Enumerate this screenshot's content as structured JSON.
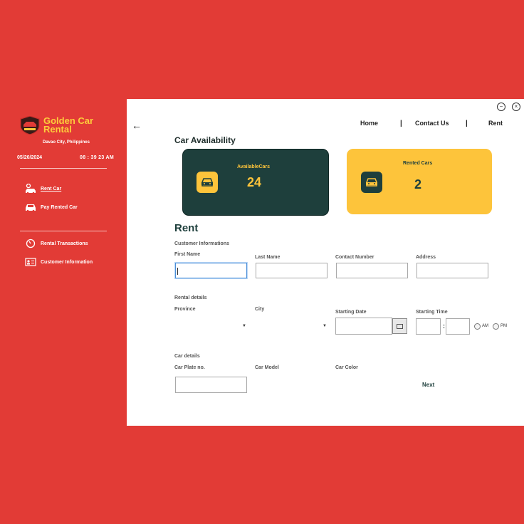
{
  "brand": {
    "name": "Golden Car Rental",
    "location": "Davao City, Philippines",
    "logo_text": "GOLDEN"
  },
  "clock": {
    "date": "05/20/2024",
    "time": "08 : 39 23 AM"
  },
  "sidebar": {
    "items": [
      {
        "label": "Rent Car",
        "icon": "car-key-icon"
      },
      {
        "label": "Pay Rented Car",
        "icon": "car-icon"
      },
      {
        "label": "Rental Transactions",
        "icon": "clock-icon"
      },
      {
        "label": "Customer Information",
        "icon": "id-card-icon"
      }
    ]
  },
  "window": {
    "minimize": "−",
    "close": "×"
  },
  "topnav": {
    "home": "Home",
    "contact": "Contact Us",
    "rent": "Rent",
    "separator": "|"
  },
  "availability": {
    "title": "Car Availability",
    "available_label": "AvailableCars",
    "available_count": "24",
    "rented_label": "Rented Cars",
    "rented_count": "2"
  },
  "form": {
    "title": "Rent",
    "customer_section": "Customer Informations",
    "first_name": "First Name",
    "last_name": "Last Name",
    "contact_number": "Contact Number",
    "address": "Address",
    "rental_section": "Rental details",
    "province": "Province",
    "city": "City",
    "starting_date": "Starting Date",
    "starting_time": "Starting Time",
    "time_sep": ":",
    "am": "AM",
    "pm": "PM",
    "car_section": "Car details",
    "plate": "Car Plate no.",
    "model": "Car Model",
    "color": "Car Color",
    "next": "Next",
    "dropdown_arrow": "▼"
  },
  "colors": {
    "background": "#e23b36",
    "accent_yellow": "#fdc43b",
    "dark_teal": "#1e3f3c"
  }
}
